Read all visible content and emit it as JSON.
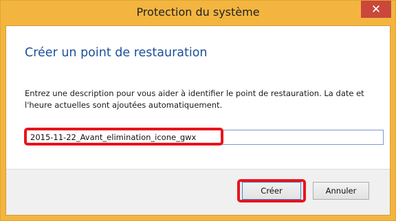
{
  "window": {
    "title": "Protection du système",
    "close_glyph": "✕"
  },
  "dialog": {
    "heading": "Créer un point de restauration",
    "description": "Entrez une description pour vous aider à identifier le point de restauration. La date et l'heure actuelles sont ajoutées automatiquement.",
    "input_value": "2015-11-22_Avant_elimination_icone_gwx"
  },
  "buttons": {
    "create": "Créer",
    "cancel": "Annuler"
  },
  "colors": {
    "titlebar": "#f3b540",
    "close_button": "#c9483b",
    "heading": "#1c4f9a",
    "highlight": "#e8141c"
  },
  "icons": {
    "close": "close-icon"
  }
}
